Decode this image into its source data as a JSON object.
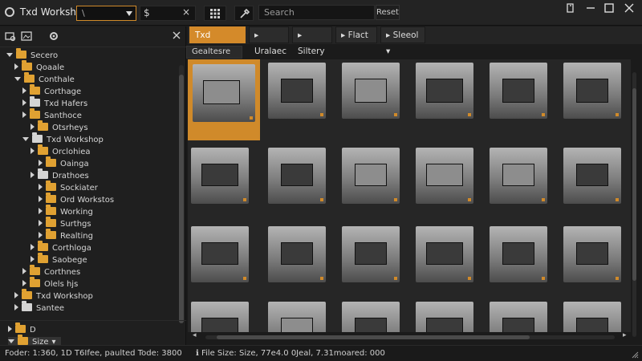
{
  "app": {
    "title": "Txd Workshop"
  },
  "toolbar": {
    "combo_value": "\\",
    "search_placeholder": "Search",
    "search_button": "Reset",
    "glyph_a": "$",
    "glyph_b": "×"
  },
  "panel": {
    "tree": [
      {
        "label": "Secero",
        "level": 0,
        "expanded": true,
        "kind": "folder"
      },
      {
        "label": "Qoaale",
        "level": 1,
        "expanded": false,
        "kind": "folder"
      },
      {
        "label": "Conthale",
        "level": 1,
        "expanded": true,
        "kind": "folder"
      },
      {
        "label": "Corthage",
        "level": 2,
        "expanded": false,
        "kind": "folder"
      },
      {
        "label": "Txd Hafers",
        "level": 2,
        "expanded": false,
        "kind": "doc"
      },
      {
        "label": "Santhoce",
        "level": 2,
        "expanded": false,
        "kind": "folder"
      },
      {
        "label": "Otsrheys",
        "level": 3,
        "expanded": false,
        "kind": "folder"
      },
      {
        "label": "Txd Workshop",
        "level": 2,
        "expanded": true,
        "kind": "doc"
      },
      {
        "label": "Orclohiea",
        "level": 3,
        "expanded": false,
        "kind": "folder"
      },
      {
        "label": "Oainga",
        "level": 4,
        "expanded": false,
        "kind": "folder"
      },
      {
        "label": "Drathoes",
        "level": 3,
        "expanded": false,
        "kind": "doc"
      },
      {
        "label": "Sockiater",
        "level": 4,
        "expanded": false,
        "kind": "folder"
      },
      {
        "label": "Ord Workstos",
        "level": 4,
        "expanded": false,
        "kind": "folder"
      },
      {
        "label": "Working",
        "level": 4,
        "expanded": false,
        "kind": "folder"
      },
      {
        "label": "Surthgs",
        "level": 4,
        "expanded": false,
        "kind": "folder"
      },
      {
        "label": "Realting",
        "level": 4,
        "expanded": false,
        "kind": "folder"
      },
      {
        "label": "Corthloga",
        "level": 3,
        "expanded": false,
        "kind": "folder"
      },
      {
        "label": "Saobege",
        "level": 3,
        "expanded": false,
        "kind": "folder"
      },
      {
        "label": "Corthnes",
        "level": 2,
        "expanded": false,
        "kind": "folder"
      },
      {
        "label": "Olels hjs",
        "level": 2,
        "expanded": false,
        "kind": "folder"
      },
      {
        "label": "Txd Workshop",
        "level": 1,
        "expanded": false,
        "kind": "folder"
      },
      {
        "label": "Santee",
        "level": 1,
        "expanded": false,
        "kind": "doc"
      }
    ],
    "bottom_items": [
      {
        "label": "D"
      },
      {
        "label": "Size"
      }
    ]
  },
  "tabs": [
    {
      "label": "Txd Workshop",
      "active": true
    },
    {
      "label": "Uralaec",
      "active": false
    },
    {
      "label": "Siltery",
      "active": false
    },
    {
      "label": "Flact",
      "active": false
    },
    {
      "label": "Sleeol",
      "active": false
    }
  ],
  "subtab": "Gealtesre",
  "grid": {
    "count": 24,
    "selected_index": 0
  },
  "status": {
    "left": "Foder: 1:360, 1D T6Ifee, paulted  Tode: 3800",
    "right": "File Size: Size, 77e4.0 0Jeal, 7.31moared: 000"
  }
}
